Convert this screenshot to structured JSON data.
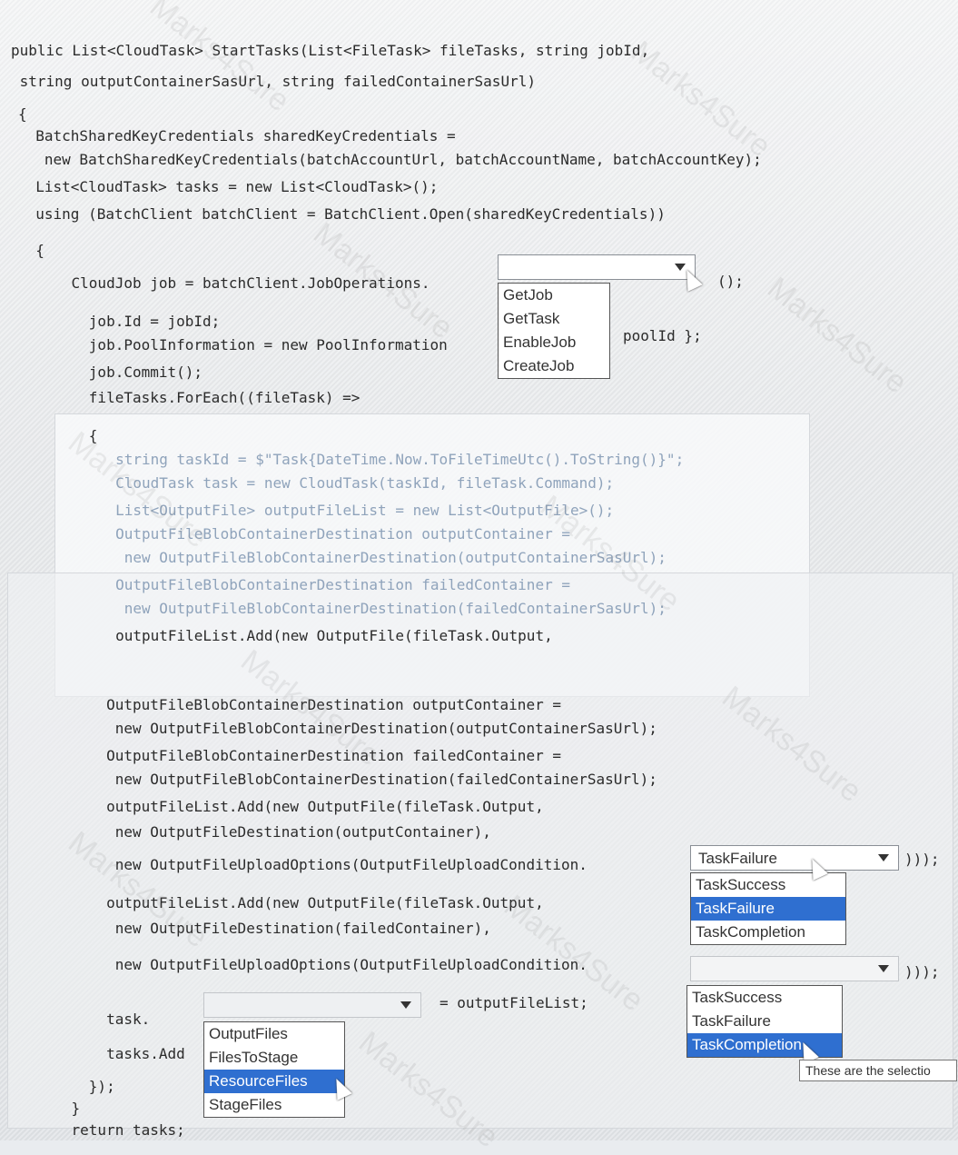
{
  "code": {
    "lines": [
      "public List<CloudTask> StartTasks(List<FileTask> fileTasks, string jobId,",
      " string outputContainerSasUrl, string failedContainerSasUrl)",
      "{",
      "  BatchSharedKeyCredentials sharedKeyCredentials =",
      "   new BatchSharedKeyCredentials(batchAccountUrl, batchAccountName, batchAccountKey);",
      "  List<CloudTask> tasks = new List<CloudTask>();",
      "  using (BatchClient batchClient = BatchClient.Open(sharedKeyCredentials))",
      "  {",
      "    CloudJob job = batchClient.JobOperations.",
      "();",
      "      job.Id = jobId;",
      "      job.PoolInformation = new PoolInformation",
      "poolId };",
      "      job.Commit();",
      "      fileTasks.ForEach((fileTask) =>",
      "      {",
      "        string taskId = $\"Task{DateTime.Now.ToFileTimeUtc().ToString()}\";",
      "        CloudTask task = new CloudTask(taskId, fileTask.Command);",
      "        List<OutputFile> outputFileList = new List<OutputFile>();",
      "        OutputFileBlobContainerDestination outputContainer =",
      "         new OutputFileBlobContainerDestination(outputContainerSasUrl);",
      "        OutputFileBlobContainerDestination failedContainer =",
      "         new OutputFileBlobContainerDestination(failedContainerSasUrl);",
      "        outputFileList.Add(new OutputFile(fileTask.Output,",
      "        OutputFileBlobContainerDestination outputContainer =",
      "         new OutputFileBlobContainerDestination(outputContainerSasUrl);",
      "        OutputFileBlobContainerDestination failedContainer =",
      "         new OutputFileBlobContainerDestination(failedContainerSasUrl);",
      "        outputFileList.Add(new OutputFile(fileTask.Output,",
      "         new OutputFileDestination(outputContainer),",
      "         new OutputFileUploadOptions(OutputFileUploadCondition.",
      "))); ",
      "        outputFileList.Add(new OutputFile(fileTask.Output,",
      "         new OutputFileDestination(failedContainer),",
      "         new OutputFileUploadOptions(OutputFileUploadCondition.",
      ")));",
      "        task.",
      "= outputFileList;",
      "        tasks.Add",
      "      });",
      "    }",
      "    return tasks;"
    ]
  },
  "dropdown1": {
    "value": "",
    "options": [
      "GetJob",
      "GetTask",
      "EnableJob",
      "CreateJob"
    ],
    "selected_index": -1
  },
  "dropdown2": {
    "value": "TaskFailure",
    "options": [
      "TaskSuccess",
      "TaskFailure",
      "TaskCompletion"
    ],
    "selected_index": 1
  },
  "dropdown3": {
    "value": "",
    "options": [
      "TaskSuccess",
      "TaskFailure",
      "TaskCompletion"
    ],
    "selected_index": 2
  },
  "dropdown4": {
    "value": "",
    "options": [
      "OutputFiles",
      "FilesToStage",
      "ResourceFiles",
      "StageFiles"
    ],
    "selected_index": 2
  },
  "tooltip": "These are the selectio",
  "watermark": "Marks4Sure",
  "colors": {
    "keyword": "#3b4fb8",
    "type": "#5e8bb0",
    "selection": "#2f6fd0"
  }
}
